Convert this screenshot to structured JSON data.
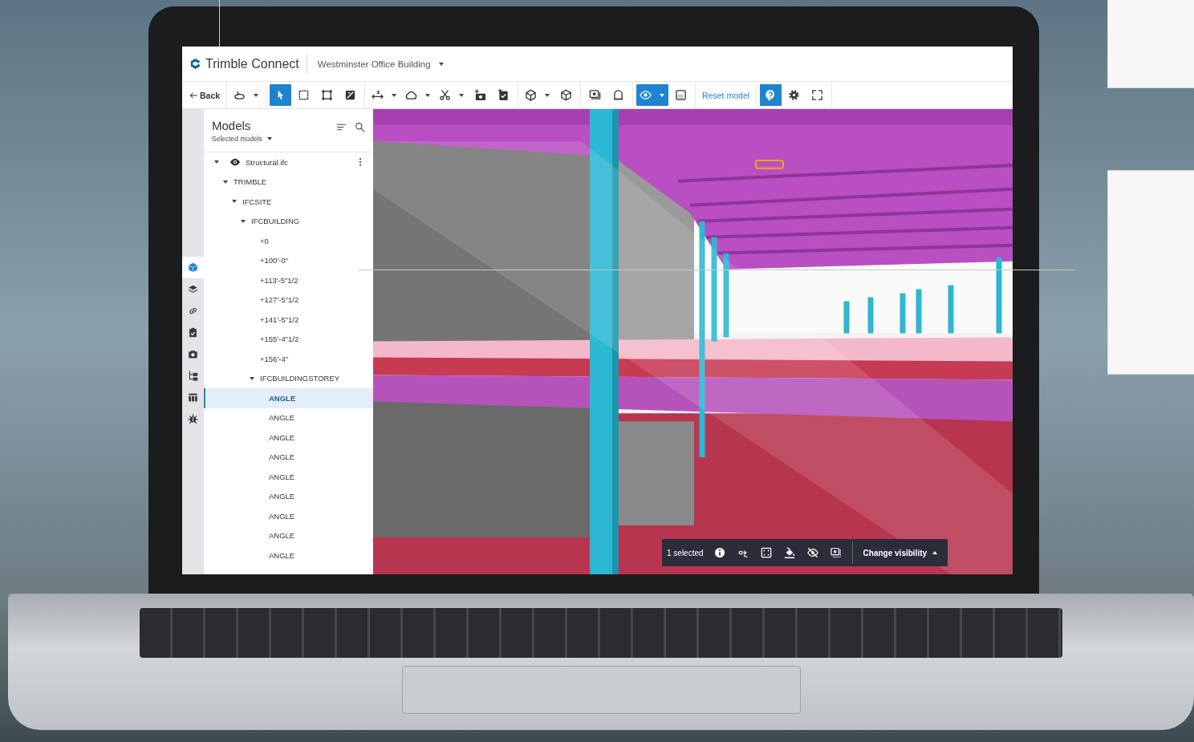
{
  "app": {
    "title": "Trimble Connect",
    "project": "Westminster Office Building"
  },
  "toolbar": {
    "groups": [
      [
        {
          "label": "Back",
          "selected": false,
          "dropdown": false
        }
      ],
      [
        {
          "selected": false,
          "dropdown": true
        }
      ],
      [
        {
          "selected": true,
          "dropdown": false
        },
        {
          "selected": false,
          "dropdown": false
        },
        {
          "selected": false,
          "dropdown": false
        },
        {
          "selected": false,
          "dropdown": false
        }
      ],
      [
        {
          "selected": false,
          "dropdown": true
        },
        {
          "selected": false,
          "dropdown": true
        },
        {
          "selected": false,
          "dropdown": true
        },
        {
          "selected": false,
          "dropdown": false
        },
        {
          "selected": false,
          "dropdown": false
        }
      ],
      [
        {
          "selected": false,
          "dropdown": true
        },
        {
          "selected": false,
          "dropdown": false
        }
      ],
      [
        {
          "selected": false,
          "dropdown": false
        },
        {
          "selected": false,
          "dropdown": false
        }
      ],
      [
        {
          "selected": true,
          "dropdown": true
        },
        {
          "selected": false,
          "dropdown": false
        }
      ],
      [
        {
          "label": "Reset model",
          "selected": false,
          "dropdown": false
        }
      ],
      [
        {
          "selected": true,
          "dropdown": false
        },
        {
          "selected": false,
          "dropdown": false
        },
        {
          "selected": false,
          "dropdown": false
        }
      ]
    ]
  },
  "rail": [
    {
      "selected": true
    },
    {
      "selected": false
    },
    {
      "selected": false
    },
    {
      "selected": false
    },
    {
      "selected": false
    },
    {
      "selected": false
    },
    {
      "selected": false
    },
    {
      "selected": false
    }
  ],
  "panel": {
    "title": "Models",
    "filter": "Selected models",
    "tree": [
      {
        "label": "Structural.ifc",
        "expanded": true,
        "selected": false,
        "children": [
          {
            "label": "TRIMBLE",
            "expanded": true,
            "selected": false,
            "children": [
              {
                "label": "IFCSITE",
                "expanded": true,
                "selected": false,
                "children": [
                  {
                    "label": "IFCBUILDING",
                    "expanded": true,
                    "selected": false,
                    "children": [
                      {
                        "label": "+0",
                        "selected": false
                      },
                      {
                        "label": "+100'-0\"",
                        "selected": false
                      },
                      {
                        "label": "+113'-5\"1/2",
                        "selected": false
                      },
                      {
                        "label": "+127'-5\"1/2",
                        "selected": false
                      },
                      {
                        "label": "+141'-5\"1/2",
                        "selected": false
                      },
                      {
                        "label": "+155'-4\"1/2",
                        "selected": false
                      },
                      {
                        "label": "+156'-4\"",
                        "selected": false
                      },
                      {
                        "label": "IFCBUILDINGSTOREY",
                        "expanded": true,
                        "selected": false,
                        "children": [
                          {
                            "label": "ANGLE",
                            "selected": true
                          },
                          {
                            "label": "ANGLE",
                            "selected": false
                          },
                          {
                            "label": "ANGLE",
                            "selected": false
                          },
                          {
                            "label": "ANGLE",
                            "selected": false
                          },
                          {
                            "label": "ANGLE",
                            "selected": false
                          },
                          {
                            "label": "ANGLE",
                            "selected": false
                          },
                          {
                            "label": "ANGLE",
                            "selected": false
                          },
                          {
                            "label": "ANGLE",
                            "selected": false
                          },
                          {
                            "label": "ANGLE",
                            "selected": false
                          }
                        ]
                      }
                    ]
                  }
                ]
              }
            ]
          }
        ]
      }
    ]
  },
  "selection_bar": {
    "count": "1 selected",
    "button": "Change visibility"
  }
}
